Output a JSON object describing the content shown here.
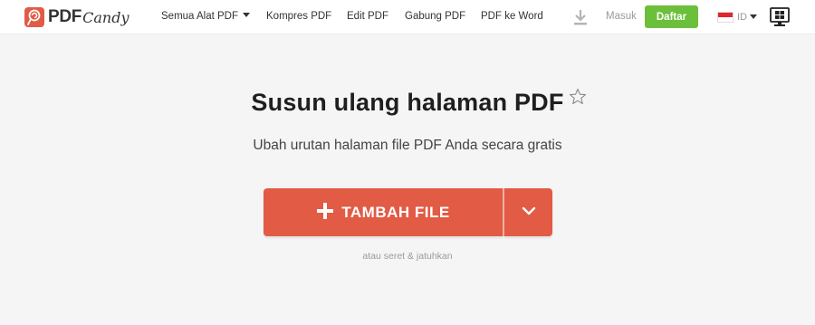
{
  "header": {
    "logo": {
      "pdf": "PDF",
      "candy": "Candy"
    },
    "nav": [
      {
        "label": "Semua Alat PDF",
        "has_caret": true
      },
      {
        "label": "Kompres PDF"
      },
      {
        "label": "Edit PDF"
      },
      {
        "label": "Gabung PDF"
      },
      {
        "label": "PDF ke Word"
      }
    ],
    "download_icon": "download-icon",
    "login_label": "Masuk",
    "signup_label": "Daftar",
    "language": {
      "code": "ID",
      "flag": "indonesia-flag"
    },
    "desktop_icon": "windows-desktop-icon"
  },
  "main": {
    "title": "Susun ulang halaman PDF",
    "favorite_icon": "star-icon",
    "subtitle": "Ubah urutan halaman file PDF Anda secara gratis",
    "add_button_label": "TAMBAH FILE",
    "add_icon": "plus-icon",
    "dropdown_icon": "chevron-down-icon",
    "drop_hint": "atau seret & jatuhkan"
  },
  "colors": {
    "brand_red": "#e25b45",
    "signup_green": "#6cbf3b",
    "background": "#f5f5f5"
  }
}
